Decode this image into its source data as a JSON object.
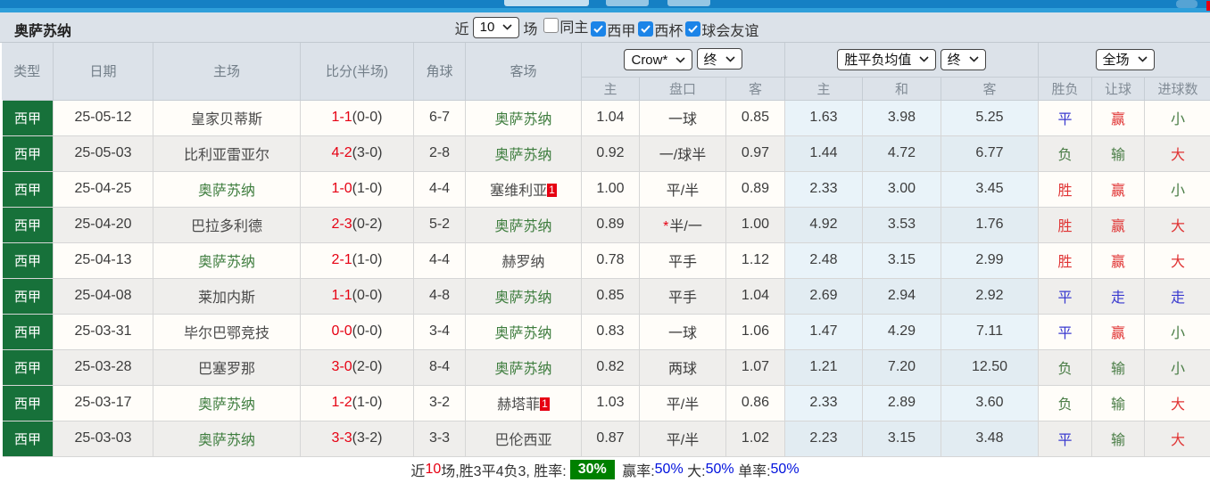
{
  "title": "奥萨苏纳",
  "colors": {
    "topbar_blue": "#1580c4",
    "accent_red": "#e60012",
    "league_green_bg": "#17713a",
    "team_green": "#3e7d3e",
    "result_red": "#e03434",
    "result_blue": "#3939cf",
    "result_green": "#4a7d46",
    "rate_green_bg": "#008000",
    "rate_blue": "#0011dd",
    "checkbox_blue": "#1b84e8"
  },
  "filters": {
    "near_label": "近",
    "count_select": "10",
    "games_label": "场",
    "checkboxes": [
      {
        "label": "同主",
        "checked": false
      },
      {
        "label": "西甲",
        "checked": true
      },
      {
        "label": "西杯",
        "checked": true
      },
      {
        "label": "球会友谊",
        "checked": true
      }
    ]
  },
  "table": {
    "main_headers": [
      "类型",
      "日期",
      "主场",
      "比分(半场)",
      "角球",
      "客场"
    ],
    "selects": {
      "odds_provider": "Crow*",
      "odds_time": "终",
      "mean_type": "胜平负均值",
      "mean_time": "终",
      "scope": "全场"
    },
    "sub_headers": [
      "主",
      "盘口",
      "客",
      "主",
      "和",
      "客",
      "胜负",
      "让球",
      "进球数"
    ],
    "rows": [
      {
        "league": "西甲",
        "date": "25-05-12",
        "home": "皇家贝蒂斯",
        "home_green": false,
        "score": "1-1",
        "half": "(0-0)",
        "corner": "6-7",
        "away": "奥萨苏纳",
        "away_green": true,
        "away_badge": "",
        "odds_home": "1.04",
        "handicap": "一球",
        "handicap_star": false,
        "odds_away": "0.85",
        "mean_home": "1.63",
        "mean_draw": "3.98",
        "mean_away": "5.25",
        "res_wdl": {
          "t": "平",
          "c": "blue"
        },
        "res_let": {
          "t": "赢",
          "c": "red"
        },
        "res_goal": {
          "t": "小",
          "c": "green"
        }
      },
      {
        "league": "西甲",
        "date": "25-05-03",
        "home": "比利亚雷亚尔",
        "home_green": false,
        "score": "4-2",
        "half": "(3-0)",
        "corner": "2-8",
        "away": "奥萨苏纳",
        "away_green": true,
        "away_badge": "",
        "odds_home": "0.92",
        "handicap": "一/球半",
        "handicap_star": false,
        "odds_away": "0.97",
        "mean_home": "1.44",
        "mean_draw": "4.72",
        "mean_away": "6.77",
        "res_wdl": {
          "t": "负",
          "c": "green"
        },
        "res_let": {
          "t": "输",
          "c": "green"
        },
        "res_goal": {
          "t": "大",
          "c": "red"
        }
      },
      {
        "league": "西甲",
        "date": "25-04-25",
        "home": "奥萨苏纳",
        "home_green": true,
        "score": "1-0",
        "half": "(1-0)",
        "corner": "4-4",
        "away": "塞维利亚",
        "away_green": false,
        "away_badge": "1",
        "odds_home": "1.00",
        "handicap": "平/半",
        "handicap_star": false,
        "odds_away": "0.89",
        "mean_home": "2.33",
        "mean_draw": "3.00",
        "mean_away": "3.45",
        "res_wdl": {
          "t": "胜",
          "c": "red"
        },
        "res_let": {
          "t": "赢",
          "c": "red"
        },
        "res_goal": {
          "t": "小",
          "c": "green"
        }
      },
      {
        "league": "西甲",
        "date": "25-04-20",
        "home": "巴拉多利德",
        "home_green": false,
        "score": "2-3",
        "half": "(0-2)",
        "corner": "5-2",
        "away": "奥萨苏纳",
        "away_green": true,
        "away_badge": "",
        "odds_home": "0.89",
        "handicap": "半/一",
        "handicap_star": true,
        "odds_away": "1.00",
        "mean_home": "4.92",
        "mean_draw": "3.53",
        "mean_away": "1.76",
        "res_wdl": {
          "t": "胜",
          "c": "red"
        },
        "res_let": {
          "t": "赢",
          "c": "red"
        },
        "res_goal": {
          "t": "大",
          "c": "red"
        }
      },
      {
        "league": "西甲",
        "date": "25-04-13",
        "home": "奥萨苏纳",
        "home_green": true,
        "score": "2-1",
        "half": "(1-0)",
        "corner": "4-4",
        "away": "赫罗纳",
        "away_green": false,
        "away_badge": "",
        "odds_home": "0.78",
        "handicap": "平手",
        "handicap_star": false,
        "odds_away": "1.12",
        "mean_home": "2.48",
        "mean_draw": "3.15",
        "mean_away": "2.99",
        "res_wdl": {
          "t": "胜",
          "c": "red"
        },
        "res_let": {
          "t": "赢",
          "c": "red"
        },
        "res_goal": {
          "t": "大",
          "c": "red"
        }
      },
      {
        "league": "西甲",
        "date": "25-04-08",
        "home": "莱加内斯",
        "home_green": false,
        "score": "1-1",
        "half": "(0-0)",
        "corner": "4-8",
        "away": "奥萨苏纳",
        "away_green": true,
        "away_badge": "",
        "odds_home": "0.85",
        "handicap": "平手",
        "handicap_star": false,
        "odds_away": "1.04",
        "mean_home": "2.69",
        "mean_draw": "2.94",
        "mean_away": "2.92",
        "res_wdl": {
          "t": "平",
          "c": "blue"
        },
        "res_let": {
          "t": "走",
          "c": "blue"
        },
        "res_goal": {
          "t": "走",
          "c": "blue"
        }
      },
      {
        "league": "西甲",
        "date": "25-03-31",
        "home": "毕尔巴鄂竞技",
        "home_green": false,
        "score": "0-0",
        "half": "(0-0)",
        "corner": "3-4",
        "away": "奥萨苏纳",
        "away_green": true,
        "away_badge": "",
        "odds_home": "0.83",
        "handicap": "一球",
        "handicap_star": false,
        "odds_away": "1.06",
        "mean_home": "1.47",
        "mean_draw": "4.29",
        "mean_away": "7.11",
        "res_wdl": {
          "t": "平",
          "c": "blue"
        },
        "res_let": {
          "t": "赢",
          "c": "red"
        },
        "res_goal": {
          "t": "小",
          "c": "green"
        }
      },
      {
        "league": "西甲",
        "date": "25-03-28",
        "home": "巴塞罗那",
        "home_green": false,
        "score": "3-0",
        "half": "(2-0)",
        "corner": "8-4",
        "away": "奥萨苏纳",
        "away_green": true,
        "away_badge": "",
        "odds_home": "0.82",
        "handicap": "两球",
        "handicap_star": false,
        "odds_away": "1.07",
        "mean_home": "1.21",
        "mean_draw": "7.20",
        "mean_away": "12.50",
        "res_wdl": {
          "t": "负",
          "c": "green"
        },
        "res_let": {
          "t": "输",
          "c": "green"
        },
        "res_goal": {
          "t": "小",
          "c": "green"
        }
      },
      {
        "league": "西甲",
        "date": "25-03-17",
        "home": "奥萨苏纳",
        "home_green": true,
        "score": "1-2",
        "half": "(1-0)",
        "corner": "3-2",
        "away": "赫塔菲",
        "away_green": false,
        "away_badge": "1",
        "odds_home": "1.03",
        "handicap": "平/半",
        "handicap_star": false,
        "odds_away": "0.86",
        "mean_home": "2.33",
        "mean_draw": "2.89",
        "mean_away": "3.60",
        "res_wdl": {
          "t": "负",
          "c": "green"
        },
        "res_let": {
          "t": "输",
          "c": "green"
        },
        "res_goal": {
          "t": "大",
          "c": "red"
        }
      },
      {
        "league": "西甲",
        "date": "25-03-03",
        "home": "奥萨苏纳",
        "home_green": true,
        "score": "3-3",
        "half": "(3-2)",
        "corner": "3-3",
        "away": "巴伦西亚",
        "away_green": false,
        "away_badge": "",
        "odds_home": "0.87",
        "handicap": "平/半",
        "handicap_star": false,
        "odds_away": "1.02",
        "mean_home": "2.23",
        "mean_draw": "3.15",
        "mean_away": "3.48",
        "res_wdl": {
          "t": "平",
          "c": "blue"
        },
        "res_let": {
          "t": "输",
          "c": "green"
        },
        "res_goal": {
          "t": "大",
          "c": "red"
        }
      }
    ]
  },
  "footer": {
    "prefix": "近",
    "count": "10",
    "mid": "场,胜3平4负3, 胜率:",
    "win_rate": "30%",
    "seg2_label": " 赢率:",
    "seg2_value": "50%",
    "seg3_label": " 大:",
    "seg3_value": "50%",
    "seg4_label": " 单率:",
    "seg4_value": "50%"
  }
}
